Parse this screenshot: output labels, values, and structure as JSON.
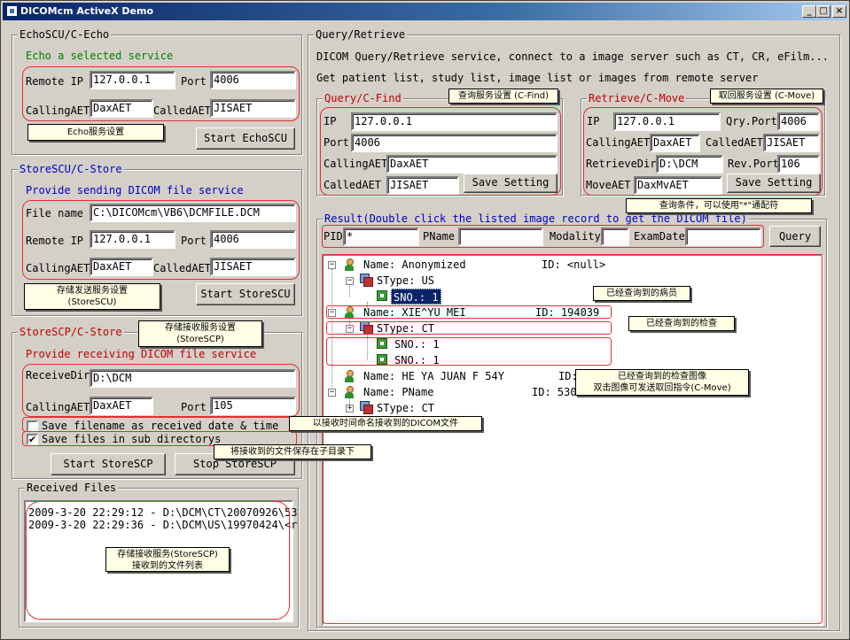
{
  "window": {
    "title": "DICOMcm ActiveX Demo",
    "min": "_",
    "max": "□",
    "close": "×"
  },
  "echo": {
    "group_title": "EchoSCU/C-Echo",
    "desc": "Echo a selected service",
    "remote_ip_label": "Remote IP",
    "remote_ip": "127.0.0.1",
    "port_label": "Port",
    "port": "4006",
    "calling_label": "CallingAET",
    "calling": "DaxAET",
    "called_label": "CalledAET",
    "called": "JISAET",
    "callout": "Echo服务设置",
    "start_btn": "Start EchoSCU"
  },
  "store": {
    "group_title": "StoreSCU/C-Store",
    "desc": "Provide sending DICOM file service",
    "file_label": "File name",
    "file": "C:\\DICOMcm\\VB6\\DCMFILE.DCM",
    "remote_ip_label": "Remote IP",
    "remote_ip": "127.0.0.1",
    "port_label": "Port",
    "port": "4006",
    "calling_label": "CallingAET",
    "calling": "DaxAET",
    "called_label": "CalledAET",
    "called": "JISAET",
    "callout": "存储发送服务设置\n(StoreSCU)",
    "start_btn": "Start StoreSCU"
  },
  "scp": {
    "group_title": "StoreSCP/C-Store",
    "desc": "Provide receiving DICOM file service",
    "callout": "存储接收服务设置\n(StoreSCP)",
    "receive_label": "ReceiveDir",
    "receive": "D:\\DCM",
    "calling_label": "CallingAET",
    "calling": "DaxAET",
    "port_label": "Port",
    "port": "105",
    "cb1_label": "Save filename as received date & time",
    "cb1_checked": false,
    "cb1_callout": "以接收时间命名接收到的DICOM文件",
    "cb2_label": "Save files in sub directorys",
    "cb2_checked": true,
    "cb2_callout": "将接收到的文件保存在子目录下",
    "start_btn": "Start StoreSCP",
    "stop_btn": "Stop StoreSCP"
  },
  "received": {
    "group_title": "Received Files",
    "rows": [
      "2009-3-20 22:29:12 - D:\\DCM\\CT\\20070926\\53",
      "2009-3-20 22:29:36 - D:\\DCM\\US\\19970424\\<r"
    ],
    "callout": "存储接收服务(StoreSCP)\n接收到的文件列表"
  },
  "qr": {
    "group_title": "Query/Retrieve",
    "desc1": "DICOM Query/Retrieve service, connect to a image server such as CT, CR, eFilm...",
    "desc2": "Get patient list, study list, image list or images from remote server",
    "find": {
      "title": "Query/C-Find",
      "callout": "查询服务设置 (C-Find)",
      "ip_label": "IP",
      "ip": "127.0.0.1",
      "port_label": "Port",
      "port": "4006",
      "calling_label": "CallingAET",
      "calling": "DaxAET",
      "called_label": "CalledAET",
      "called": "JISAET",
      "save_btn": "Save Setting"
    },
    "move": {
      "title": "Retrieve/C-Move",
      "callout": "取回服务设置 (C-Move)",
      "ip_label": "IP",
      "ip": "127.0.0.1",
      "qport_label": "Qry.Port",
      "qport": "4006",
      "calling_label": "CallingAET",
      "calling": "DaxAET",
      "called_label": "CalledAET",
      "called": "JISAET",
      "rdir_label": "RetrieveDir",
      "rdir": "D:\\DCM",
      "rport_label": "Rev.Port",
      "rport": "106",
      "moveaet_label": "MoveAET",
      "moveaet": "DaxMvAET",
      "save_btn": "Save Setting"
    },
    "result": {
      "title": "Result(Double click the listed image record to get the DICOM file)",
      "cond_callout": "查询条件，可以使用\"*\"通配符",
      "pid_label": "PID",
      "pid": "*",
      "pname_label": "PName",
      "pname": "",
      "modality_label": "Modality",
      "modality": "",
      "examdate_label": "ExamDate",
      "examdate": "",
      "query_btn": "Query"
    },
    "tree": {
      "p1_name": "Name: Anonymized",
      "p1_id": "ID: <null>",
      "p1_stype": "SType: US",
      "p1_sno": "SNO.: 1",
      "p2_name": "Name: XIE^YU MEI",
      "p2_id": "ID: 194039",
      "p2_stype": "SType: CT",
      "p2_sno1": "SNO.: 1",
      "p2_sno2": "SNO.: 1",
      "p3_name": "Name: HE YA JUAN F 54Y",
      "p3_id": "ID:",
      "p4_name": "Name: PName",
      "p4_id": "ID: 5306",
      "p4_stype": "SType: CT",
      "callout_patient": "已经查询到的病员",
      "callout_study": "已经查询到的检查",
      "callout_image": "已经查询到的检查图像\n双击图像可发送取回指令(C-Move)"
    }
  }
}
